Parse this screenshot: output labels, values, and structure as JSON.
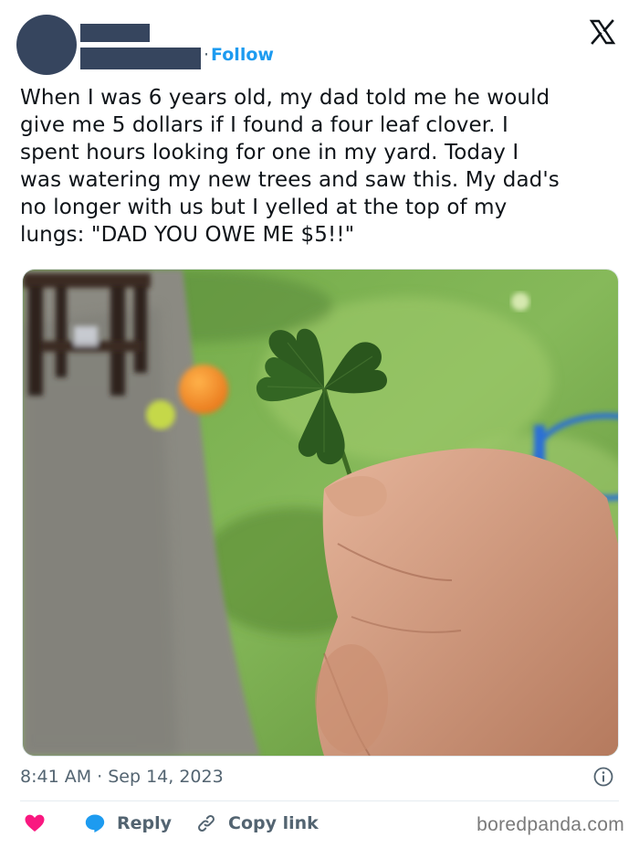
{
  "header": {
    "follow_label": "Follow",
    "separator": "·"
  },
  "tweet": {
    "text": "When I was 6 years old, my dad told me he would\ngive me 5 dollars if I found a four leaf clover. I\nspent hours looking for one in my yard. Today I\nwas watering my new trees and saw this. My dad's\nno longer with us but I yelled at the top of my\nlungs: \"DAD YOU OWE ME $5!!\"",
    "time": "8:41 AM",
    "date": "Sep 14, 2023"
  },
  "actions": {
    "reply_label": "Reply",
    "copy_label": "Copy link"
  },
  "watermark": "boredpanda.com",
  "icons": [
    "x-logo-icon",
    "info-icon",
    "heart-icon",
    "reply-bubble-icon",
    "link-icon"
  ],
  "colors": {
    "accent": "#1d9bf0",
    "heart": "#f91880",
    "muted": "#536471",
    "redaction": "#36455e"
  }
}
